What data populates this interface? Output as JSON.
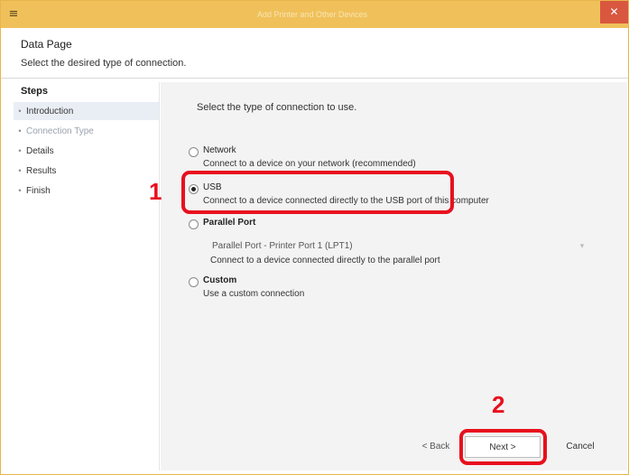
{
  "window": {
    "title": "Add Printer and Other Devices"
  },
  "icons": {
    "app": "≡",
    "close": "✕",
    "dropdown": "▾"
  },
  "header": {
    "title": "Data Page",
    "subtitle": "Select the desired type of connection."
  },
  "sidebar": {
    "heading": "Steps",
    "items": [
      {
        "label": "Introduction",
        "active": true
      },
      {
        "label": "Connection Type",
        "dim": true
      },
      {
        "label": "Details"
      },
      {
        "label": "Results"
      },
      {
        "label": "Finish"
      }
    ]
  },
  "content": {
    "question": "Select the type of connection to use.",
    "options": [
      {
        "title": "Network",
        "desc": "Connect to a device on your network (recommended)",
        "checked": false
      },
      {
        "title": "USB",
        "desc": "Connect to a device connected directly to the USB port of this computer",
        "checked": true
      },
      {
        "title": "Parallel Port",
        "desc": "Connect to a device connected directly to the parallel port",
        "checked": false
      },
      {
        "title": "Custom",
        "desc": "Use a custom connection",
        "checked": false
      }
    ],
    "port_value": "Parallel Port - Printer Port 1 (LPT1)"
  },
  "callouts": {
    "one": "1",
    "two": "2"
  },
  "buttons": {
    "back": "< Back",
    "next": "Next >",
    "cancel": "Cancel"
  },
  "colors": {
    "titlebar": "#f0c15a",
    "close": "#d9573f",
    "highlight": "#e8101e",
    "content_bg": "#f3f3f3"
  }
}
